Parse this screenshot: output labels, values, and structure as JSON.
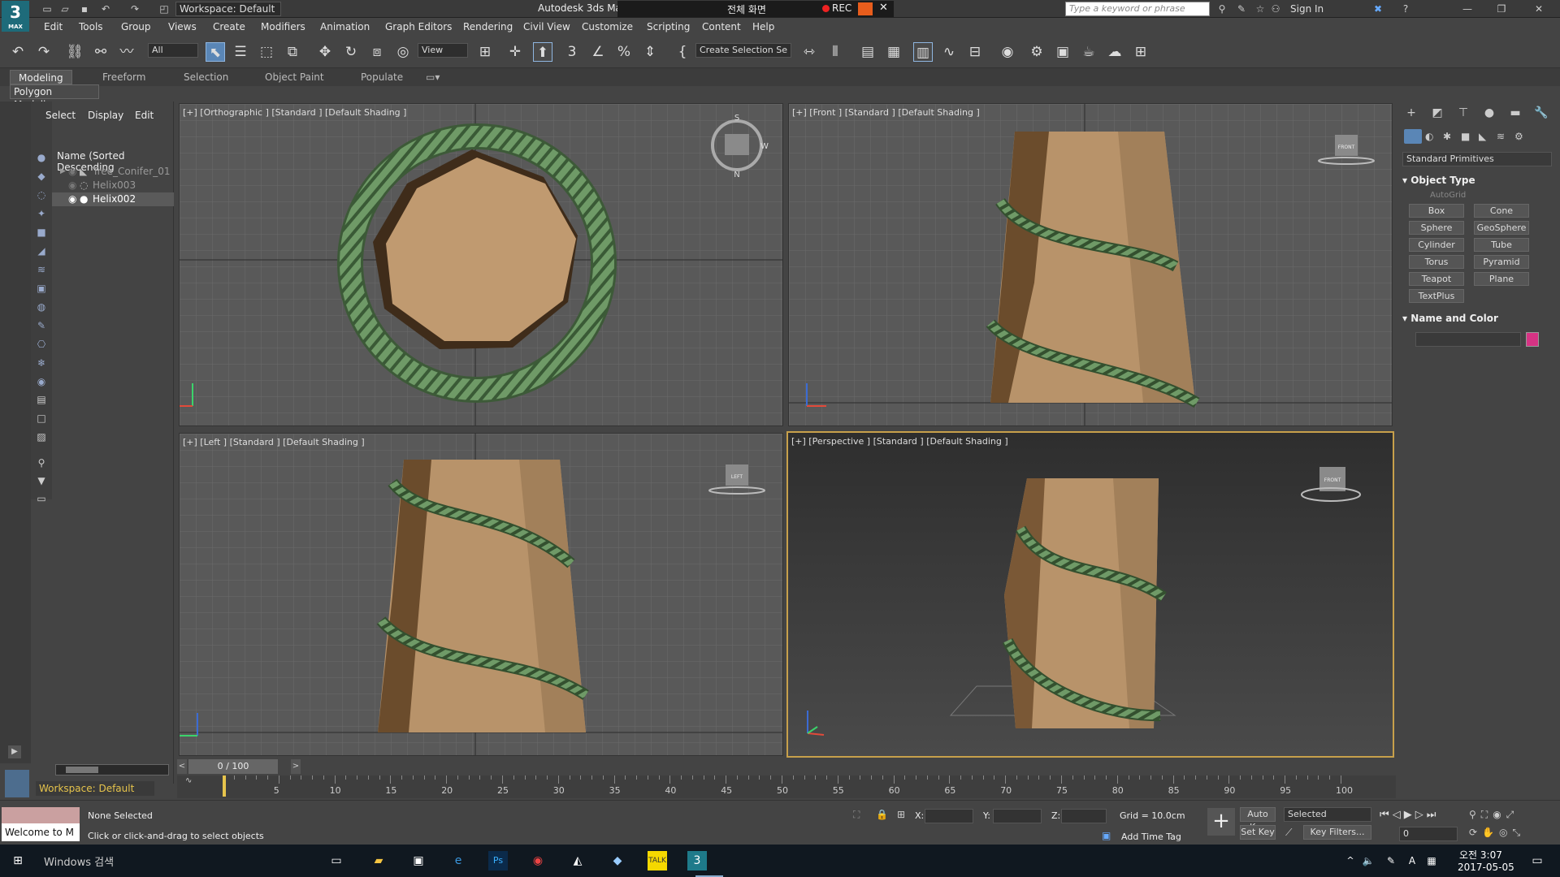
{
  "app": {
    "logo_text": "3",
    "logo_sub": "MAX",
    "workspace": "Workspace: Default",
    "title": "Autodesk 3ds Ma",
    "recorder_title": "전체 화면",
    "recorder_rec": "REC",
    "search_placeholder": "Type a keyword or phrase",
    "sign_in": "Sign In"
  },
  "menu": [
    "Edit",
    "Tools",
    "Group",
    "Views",
    "Create",
    "Modifiers",
    "Animation",
    "Graph Editors",
    "Rendering",
    "Civil View",
    "Customize",
    "Scripting",
    "Content",
    "Help"
  ],
  "toolbar": {
    "filter": "All",
    "ref_coord": "View",
    "selection_set": "Create Selection Se"
  },
  "ribbon": {
    "tabs": [
      "Modeling",
      "Freeform",
      "Selection",
      "Object Paint",
      "Populate"
    ],
    "panel": "Polygon Modeling"
  },
  "scene_explorer": {
    "tabs": [
      "Select",
      "Display",
      "Edit"
    ],
    "column": "Name (Sorted Descending",
    "rows": [
      "Tree_Conifer_01",
      "Helix003",
      "Helix002"
    ],
    "workspace": "Workspace: Default"
  },
  "viewports": {
    "top": "[+] [Orthographic ] [Standard ] [Default Shading ]",
    "front": "[+] [Front ] [Standard ] [Default Shading ]",
    "left": "[+] [Left ] [Standard ] [Default Shading ]",
    "persp": "[+] [Perspective ] [Standard ] [Default Shading ]",
    "compass_n": "N",
    "compass_s": "S",
    "compass_w": "W",
    "viewcube_front": "FRONT",
    "viewcube_left": "LEFT"
  },
  "command_panel": {
    "category": "Standard Primitives",
    "object_type": "Object Type",
    "autogrid": "AutoGrid",
    "primitives": [
      "Box",
      "Cone",
      "Sphere",
      "GeoSphere",
      "Cylinder",
      "Tube",
      "Torus",
      "Pyramid",
      "Teapot",
      "Plane",
      "TextPlus"
    ],
    "name_and_color": "Name and Color",
    "color_swatch": "#d63384"
  },
  "timeline": {
    "frame": "0 / 100",
    "ticks": [
      "5",
      "10",
      "15",
      "20",
      "25",
      "30",
      "35",
      "40",
      "45",
      "50",
      "55",
      "60",
      "65",
      "70",
      "75",
      "80",
      "85",
      "90",
      "95",
      "100"
    ]
  },
  "status": {
    "selection": "None Selected",
    "prompt": "Click or click-and-drag to select objects",
    "welcome": "Welcome to M",
    "x_label": "X:",
    "y_label": "Y:",
    "z_label": "Z:",
    "grid": "Grid = 10.0cm",
    "add_time_tag": "Add Time Tag",
    "auto_key": "Auto Key",
    "set_key": "Set Key",
    "selected": "Selected",
    "key_filters": "Key Filters...",
    "frame_field": "0"
  },
  "taskbar": {
    "search": "Windows 검색",
    "time": "오전 3:07",
    "date": "2017-05-05"
  }
}
